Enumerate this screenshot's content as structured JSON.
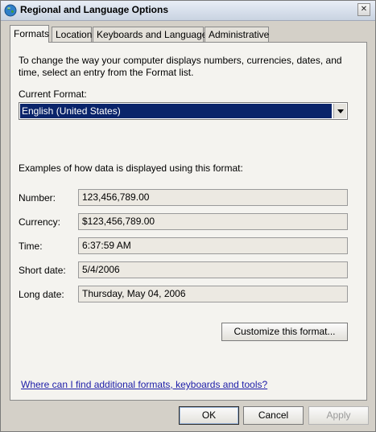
{
  "window": {
    "title": "Regional and Language Options",
    "close_label": "✕"
  },
  "tabs": [
    {
      "label": "Formats",
      "active": true
    },
    {
      "label": "Location",
      "active": false
    },
    {
      "label": "Keyboards and Languages",
      "active": false
    },
    {
      "label": "Administrative",
      "active": false
    }
  ],
  "formats": {
    "intro": "To change the way your computer displays numbers, currencies, dates, and time, select an entry from the Format list.",
    "current_format_label": "Current Format:",
    "current_format_value": "English (United States)",
    "examples_label": "Examples of how data is displayed using this format:",
    "rows": [
      {
        "label": "Number:",
        "value": "123,456,789.00"
      },
      {
        "label": "Currency:",
        "value": "$123,456,789.00"
      },
      {
        "label": "Time:",
        "value": "6:37:59 AM"
      },
      {
        "label": "Short date:",
        "value": "5/4/2006"
      },
      {
        "label": "Long date:",
        "value": "Thursday, May 04, 2006"
      }
    ],
    "customize_label": "Customize this format...",
    "help_link": "Where can I find additional formats, keyboards and tools?"
  },
  "buttons": {
    "ok": "OK",
    "cancel": "Cancel",
    "apply": "Apply"
  },
  "icons": {
    "window": "globe-icon",
    "dropdown": "dropdown-arrow-icon",
    "close": "close-icon"
  }
}
